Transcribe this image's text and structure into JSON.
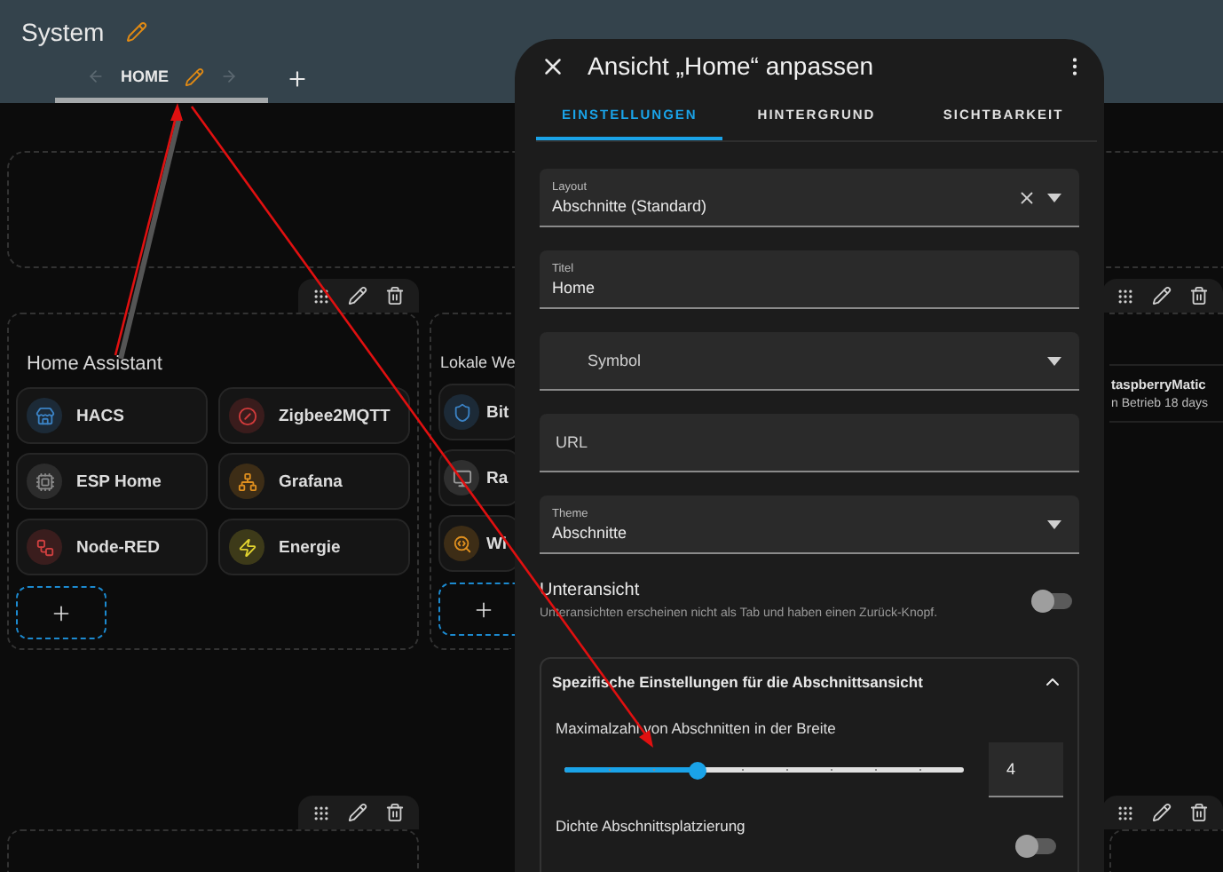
{
  "header": {
    "title": "System",
    "tabs": [
      {
        "label": "HOME",
        "selected": true
      }
    ]
  },
  "sections": [
    {
      "title": "Home Assistant",
      "cards": [
        {
          "name": "HACS",
          "color": "#3b82c4"
        },
        {
          "name": "Zigbee2MQTT",
          "color": "#d23b3b"
        },
        {
          "name": "ESP Home",
          "color": "#8a8a8a"
        },
        {
          "name": "Grafana",
          "color": "#e0901f"
        },
        {
          "name": "Node-RED",
          "color": "#d04040"
        },
        {
          "name": "Energie",
          "color": "#e2d32f"
        }
      ]
    },
    {
      "title": "Lokale We",
      "cards": [
        {
          "name": "Bit",
          "color": "#3b82c4"
        },
        {
          "name": "Ra",
          "color": "#9a9a9a"
        },
        {
          "name": "Wi",
          "color": "#e0901f"
        }
      ]
    }
  ],
  "right_card": {
    "name": "taspberryMatic",
    "status": "n Betrieb 18 days"
  },
  "dialog": {
    "title": "Ansicht „Home“ anpassen",
    "tabs": [
      {
        "label": "EINSTELLUNGEN",
        "selected": true
      },
      {
        "label": "HINTERGRUND",
        "selected": false
      },
      {
        "label": "SICHTBARKEIT",
        "selected": false
      }
    ],
    "fields": [
      {
        "kind": "select",
        "label": "Layout",
        "value": "Abschnitte (Standard)",
        "clearable": true
      },
      {
        "kind": "text",
        "label": "Titel",
        "value": "Home"
      },
      {
        "kind": "icon",
        "placeholder": "Symbol"
      },
      {
        "kind": "text",
        "placeholder": "URL"
      },
      {
        "kind": "select",
        "label": "Theme",
        "value": "Abschnitte",
        "clearable": false
      }
    ],
    "subview": {
      "title": "Unteransicht",
      "description": "Unteransichten erscheinen nicht als Tab und haben einen Zurück-Knopf.",
      "on": false
    },
    "panel": {
      "title": "Spezifische Einstellungen für die Abschnittsansicht",
      "expanded": true,
      "slider": {
        "label": "Maximalzahl von Abschnitten in der Breite",
        "level": 0.333,
        "value": "4"
      },
      "dense": {
        "label": "Dichte Abschnittsplatzierung",
        "on": false
      }
    }
  }
}
